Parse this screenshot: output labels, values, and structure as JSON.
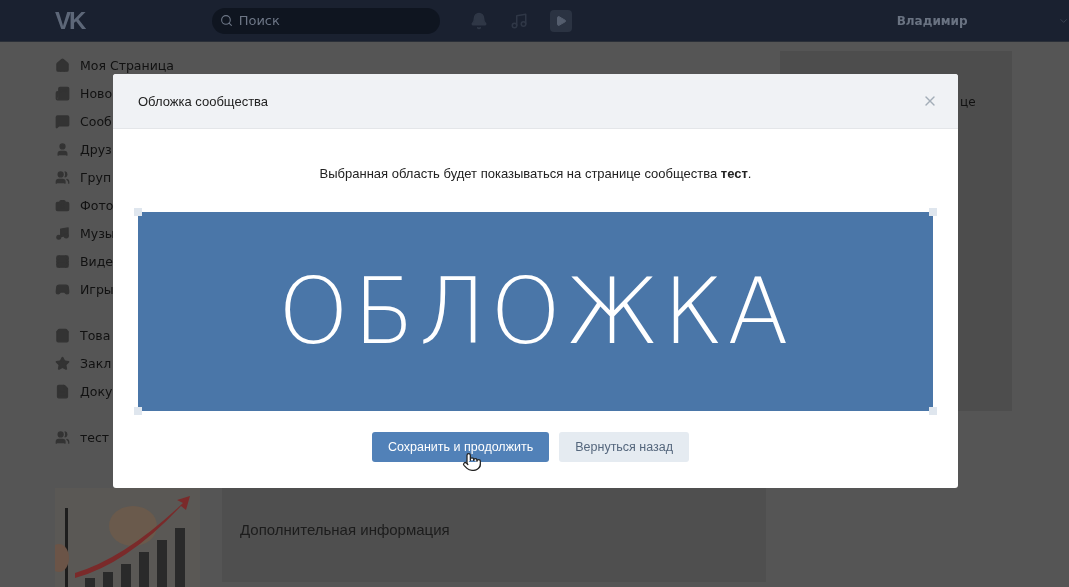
{
  "header": {
    "logo": "VK",
    "search": {
      "placeholder": "Поиск"
    },
    "user_name": "Владимир"
  },
  "sidebar": {
    "groups": [
      [
        "Моя Страница",
        "Ново",
        "Сооб",
        "Друз",
        "Груп",
        "Фото",
        "Музы",
        "Виде",
        "Игры"
      ],
      [
        "Това",
        "Закл",
        "Доку"
      ],
      [
        "тест"
      ]
    ]
  },
  "right_panel": {
    "text": "це"
  },
  "info_card": {
    "title": "Дополнительная информация"
  },
  "modal": {
    "title": "Обложка сообщества",
    "message": "Выбранная область будет показываться на странице сообщества **тест**.",
    "cover_text": "ОБЛОЖКА",
    "buttons": [
      {
        "label": "Сохранить и продолжить",
        "kind": "primary"
      },
      {
        "label": "Вернуться назад",
        "kind": "secondary"
      }
    ]
  }
}
